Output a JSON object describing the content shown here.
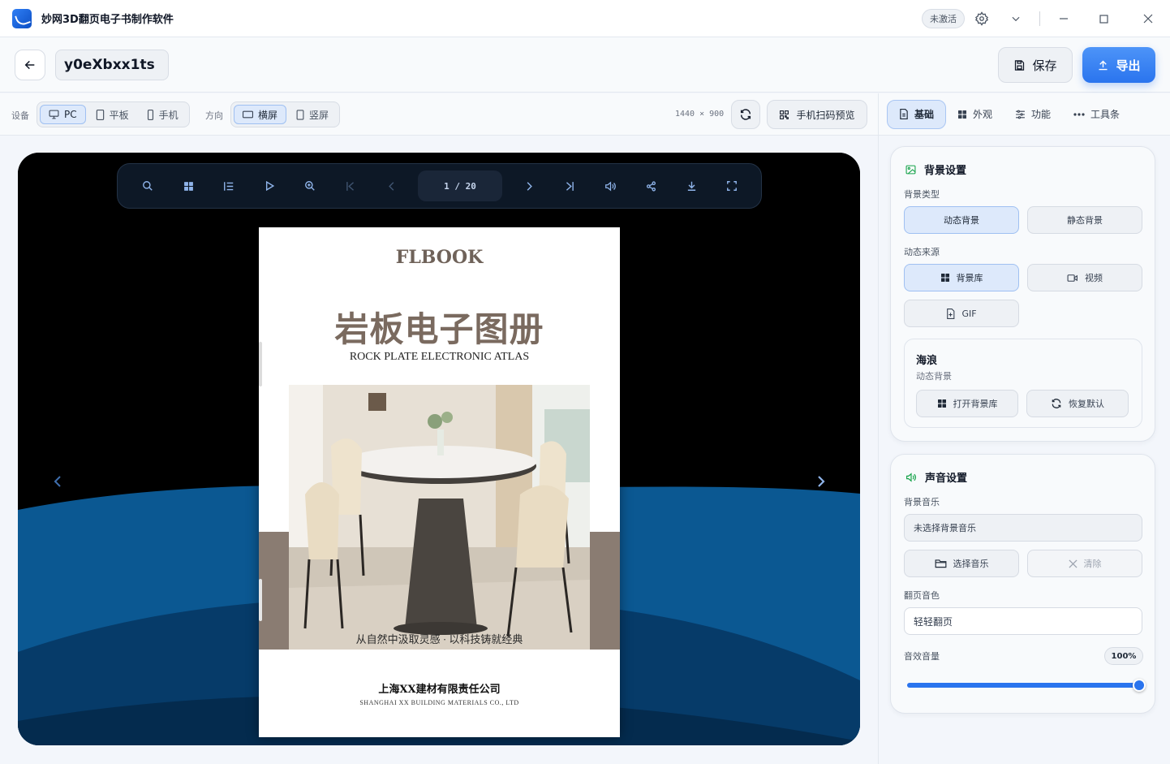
{
  "app": {
    "title": "妙网3D翻页电子书制作软件",
    "activation_badge": "未激活"
  },
  "header": {
    "document_name": "y0eXbxx1ts",
    "save_label": "保存",
    "export_label": "导出"
  },
  "toolbar": {
    "device_label": "设备",
    "devices": [
      {
        "label": "PC",
        "active": true
      },
      {
        "label": "平板",
        "active": false
      },
      {
        "label": "手机",
        "active": false
      }
    ],
    "orientation_label": "方向",
    "orientations": [
      {
        "label": "横屏",
        "active": true
      },
      {
        "label": "竖屏",
        "active": false
      }
    ],
    "resolution": "1440 × 900",
    "qr_preview_label": "手机扫码预览"
  },
  "reader": {
    "page_counter": "1 / 20",
    "icons": [
      "search-icon",
      "thumbnails-icon",
      "toc-icon",
      "play-icon",
      "zoom-in-icon",
      "first-page-icon",
      "prev-page-icon",
      "next-page-icon",
      "last-page-icon",
      "sound-icon",
      "share-icon",
      "download-icon",
      "fullscreen-icon"
    ]
  },
  "book_page": {
    "logo": "FLBOOK",
    "title": "岩板电子图册",
    "subtitle": "ROCK PLATE ELECTRONIC ATLAS",
    "caption": "从自然中汲取灵感 · 以科技铸就经典",
    "company": "上海XX建材有限责任公司",
    "company_en": "SHANGHAI XX BUILDING MATERIALS CO., LTD"
  },
  "right_tabs": [
    {
      "label": "基础",
      "active": true
    },
    {
      "label": "外观",
      "active": false
    },
    {
      "label": "功能",
      "active": false
    },
    {
      "label": "工具条",
      "active": false
    }
  ],
  "background_settings": {
    "title": "背景设置",
    "type_label": "背景类型",
    "type_dynamic": "动态背景",
    "type_static": "静态背景",
    "source_label": "动态来源",
    "source_library": "背景库",
    "source_video": "视频",
    "source_gif": "GIF",
    "current_name": "海浪",
    "current_desc": "动态背景",
    "open_library": "打开背景库",
    "restore_default": "恢复默认"
  },
  "sound_settings": {
    "title": "声音设置",
    "music_label": "背景音乐",
    "music_placeholder": "未选择背景音乐",
    "choose_music": "选择音乐",
    "clear": "清除",
    "flip_sound_label": "翻页音色",
    "flip_sound_value": "轻轻翻页",
    "volume_label": "音效音量",
    "volume_display": "100%",
    "volume": 1.0
  },
  "colors": {
    "accent": "#2a74ee",
    "wave_light": "#0b5892",
    "wave_dark": "#042b4e",
    "page_band": "#8a7c72",
    "title_brown": "#7a6a5f"
  }
}
